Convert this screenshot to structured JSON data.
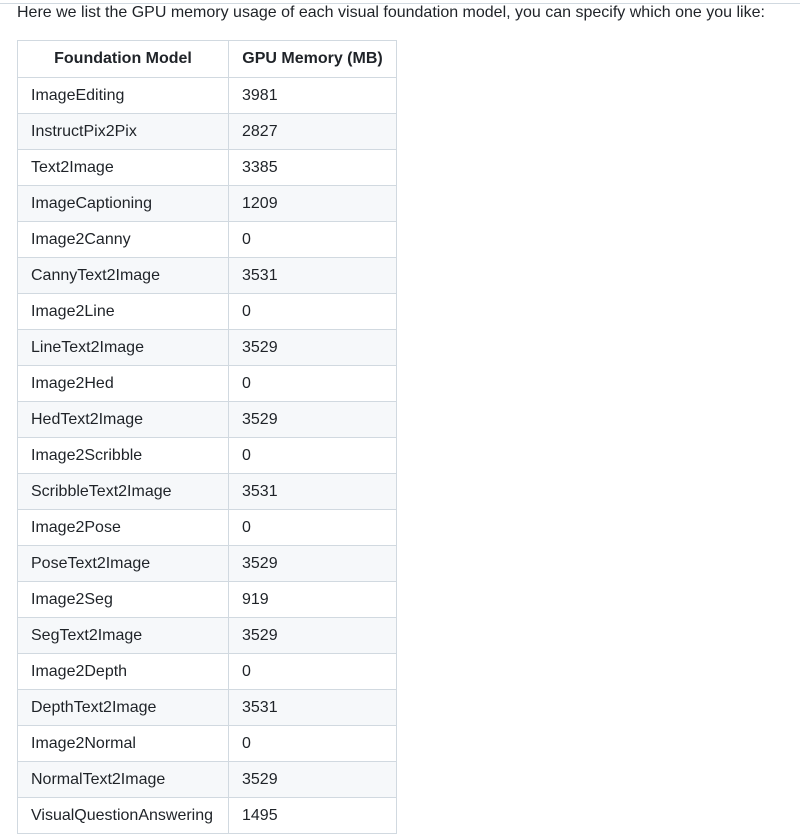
{
  "intro_text": "Here we list the GPU memory usage of each visual foundation model, you can specify which one you like:",
  "table": {
    "headers": {
      "model": "Foundation Model",
      "memory": "GPU Memory (MB)"
    },
    "rows": [
      {
        "model": "ImageEditing",
        "memory": "3981"
      },
      {
        "model": "InstructPix2Pix",
        "memory": "2827"
      },
      {
        "model": "Text2Image",
        "memory": "3385"
      },
      {
        "model": "ImageCaptioning",
        "memory": "1209"
      },
      {
        "model": "Image2Canny",
        "memory": "0"
      },
      {
        "model": "CannyText2Image",
        "memory": "3531"
      },
      {
        "model": "Image2Line",
        "memory": "0"
      },
      {
        "model": "LineText2Image",
        "memory": "3529"
      },
      {
        "model": "Image2Hed",
        "memory": "0"
      },
      {
        "model": "HedText2Image",
        "memory": "3529"
      },
      {
        "model": "Image2Scribble",
        "memory": "0"
      },
      {
        "model": "ScribbleText2Image",
        "memory": "3531"
      },
      {
        "model": "Image2Pose",
        "memory": "0"
      },
      {
        "model": "PoseText2Image",
        "memory": "3529"
      },
      {
        "model": "Image2Seg",
        "memory": "919"
      },
      {
        "model": "SegText2Image",
        "memory": "3529"
      },
      {
        "model": "Image2Depth",
        "memory": "0"
      },
      {
        "model": "DepthText2Image",
        "memory": "3531"
      },
      {
        "model": "Image2Normal",
        "memory": "0"
      },
      {
        "model": "NormalText2Image",
        "memory": "3529"
      },
      {
        "model": "VisualQuestionAnswering",
        "memory": "1495"
      }
    ]
  },
  "colors": {
    "text": "#1f2328",
    "border": "#d1d9e0",
    "stripe": "#f6f8fa"
  }
}
